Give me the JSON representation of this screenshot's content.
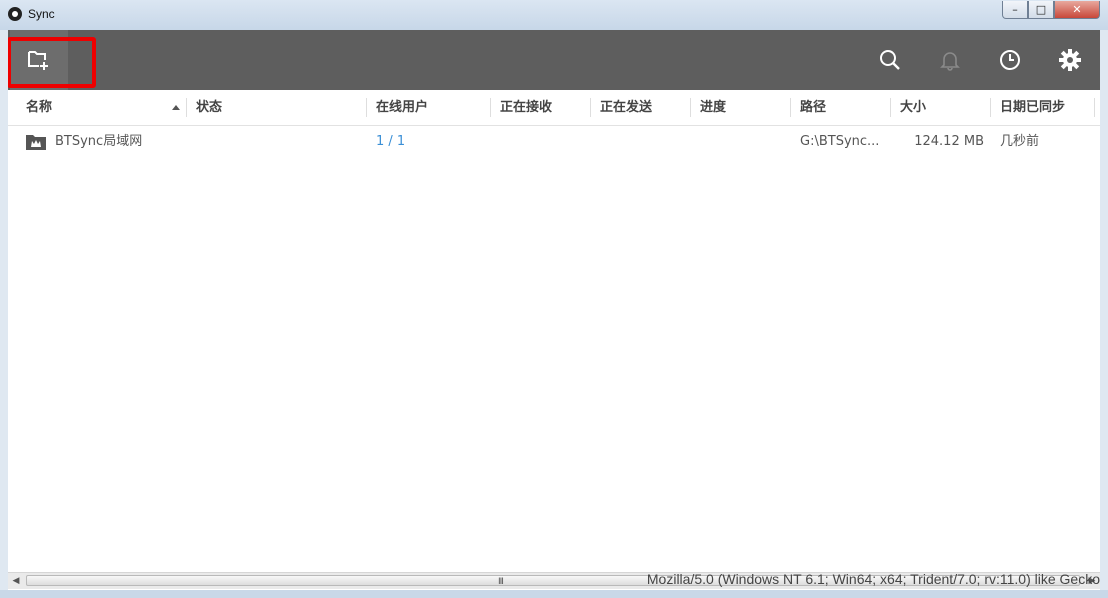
{
  "window": {
    "title": "Sync",
    "controls": {
      "minimize": "–",
      "maximize": "□",
      "close": "✕"
    }
  },
  "toolbar": {
    "add_folder_icon": "folder-plus-icon",
    "search_icon": "search-icon",
    "notifications_icon": "bell-icon",
    "history_icon": "clock-icon",
    "settings_icon": "gear-icon",
    "highlight_color": "#ee0000"
  },
  "columns": {
    "name": "名称",
    "status": "状态",
    "online_users": "在线用户",
    "receiving": "正在接收",
    "sending": "正在发送",
    "progress": "进度",
    "path": "路径",
    "size": "大小",
    "last_synced": "日期已同步"
  },
  "folders": [
    {
      "name": "BTSync局域网",
      "status": "",
      "online_users": "1 / 1",
      "receiving": "",
      "sending": "",
      "progress": "",
      "path": "G:\\BTSync...",
      "size": "124.12 MB",
      "last_synced": "几秒前"
    }
  ],
  "status_bar": {
    "user_agent": "Mozilla/5.0 (Windows NT 6.1; Win64; x64; Trident/7.0; rv:11.0) like Gecko",
    "scroll_grip": "III"
  },
  "colors": {
    "toolbar_bg": "#5e5e5e",
    "link": "#3a8fd6"
  }
}
